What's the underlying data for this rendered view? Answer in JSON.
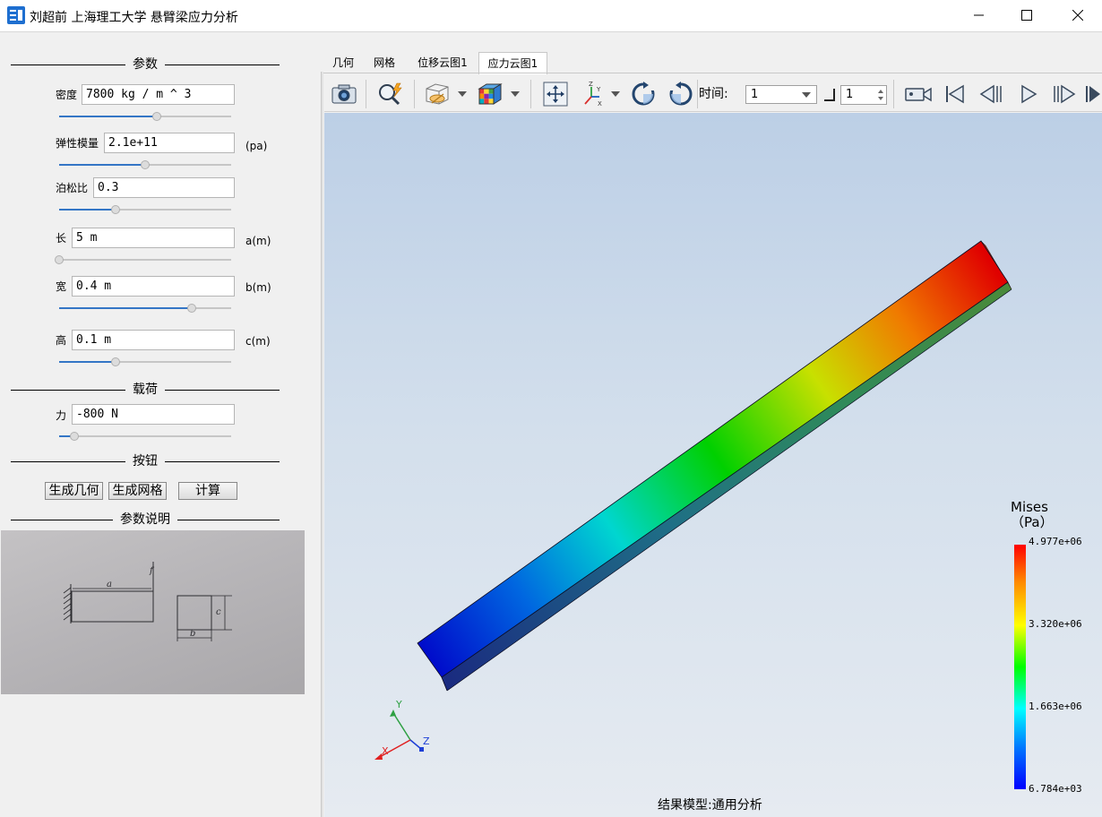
{
  "window": {
    "title": "刘超前 上海理工大学 悬臂梁应力分析"
  },
  "sections": {
    "params": "参数",
    "load": "载荷",
    "buttons": "按钮",
    "description": "参数说明"
  },
  "params": {
    "density": {
      "label": "密度",
      "value": "7800 kg / m ^ 3",
      "unit": "",
      "slider_fraction": 0.57
    },
    "modulus": {
      "label": "弹性模量",
      "value": "2.1e+11",
      "unit": "(pa)",
      "slider_fraction": 0.5
    },
    "poisson": {
      "label": "泊松比",
      "value": "0.3",
      "unit": "",
      "slider_fraction": 0.33
    },
    "length": {
      "label": "长",
      "value": "5 m",
      "unit": "a(m)",
      "slider_fraction": 0.0
    },
    "width": {
      "label": "宽",
      "value": "0.4 m",
      "unit": "b(m)",
      "slider_fraction": 0.77
    },
    "height": {
      "label": "高",
      "value": "0.1 m",
      "unit": "c(m)",
      "slider_fraction": 0.33
    }
  },
  "load": {
    "force": {
      "label": "力",
      "value": "-800 N",
      "slider_fraction": 0.09
    }
  },
  "actions": {
    "generate_geometry": "生成几何",
    "generate_mesh": "生成网格",
    "compute": "计算"
  },
  "sketch": {
    "labels": {
      "a": "a",
      "b": "b",
      "c": "c",
      "f": "f"
    }
  },
  "tabs": [
    {
      "label": "几何"
    },
    {
      "label": "网格"
    },
    {
      "label": "位移云图1"
    },
    {
      "label": "应力云图1",
      "active": true
    }
  ],
  "toolbar": {
    "time_label": "时间:",
    "time_value": "1",
    "step_value": "1",
    "icons": [
      "camera-icon",
      "zoom-icon",
      "visibility-icon",
      "colormap-icon",
      "fit-view-icon",
      "axes-icon",
      "rotate-left-icon",
      "rotate-right-icon",
      "record-icon",
      "first-frame-icon",
      "prev-frame-icon",
      "play-icon",
      "next-frame-icon"
    ]
  },
  "legend": {
    "title_line1": "Mises",
    "title_line2": "（Pa）",
    "values": [
      "4.977e+06",
      "3.320e+06",
      "1.663e+06",
      "6.784e+03"
    ],
    "colors": [
      "#ff0000",
      "#ffff00",
      "#00ff00",
      "#00ffff",
      "#0000ff"
    ]
  },
  "axes": {
    "x": "X",
    "y": "Y",
    "z": "Z"
  },
  "model_label": "结果模型:通用分析"
}
